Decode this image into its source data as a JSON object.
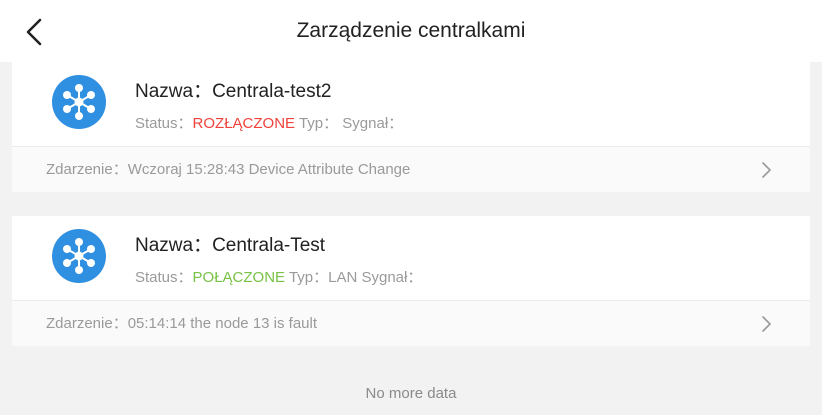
{
  "header": {
    "title": "Zarządzenie centralkami",
    "back_icon": "chevron-left-icon"
  },
  "colors": {
    "accent": "#2f8fe0",
    "disconnected": "#f0413a",
    "connected": "#77c244"
  },
  "devices": [
    {
      "name_label": "Nazwa：",
      "name_value": "Centrala-test2",
      "status_label": "Status：",
      "status_value": "ROZŁĄCZONE",
      "type_label": " Typ：",
      "type_value": "",
      "signal_label": " Sygnał：",
      "event_label": "Zdarzenie：",
      "event_value": "Wczoraj 15:28:43 Device Attribute Change",
      "icon": "hub-icon"
    },
    {
      "name_label": "Nazwa：",
      "name_value": "Centrala-Test",
      "status_label": "Status：",
      "status_value": "POŁĄCZONE",
      "type_label": " Typ：",
      "type_value": "LAN",
      "signal_label": " Sygnał：",
      "event_label": "Zdarzenie：",
      "event_value": "05:14:14 the node 13 is fault",
      "icon": "hub-icon"
    }
  ],
  "footer": {
    "no_more": "No more data"
  }
}
